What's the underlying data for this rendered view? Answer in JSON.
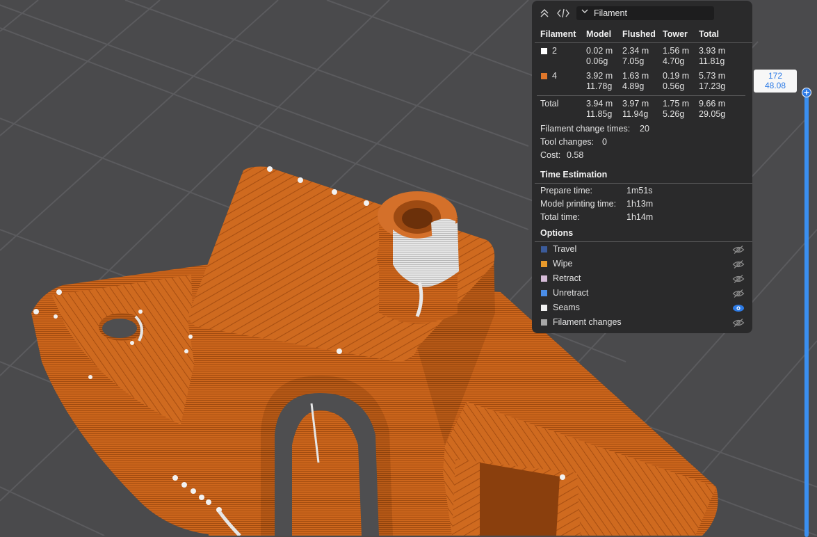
{
  "header": {
    "collapse_icon": "double-chevron-up-icon",
    "code_icon": "code-brackets-icon",
    "view_type": "Filament"
  },
  "table": {
    "columns": [
      "Filament",
      "Model",
      "Flushed",
      "Tower",
      "Total"
    ],
    "rows": [
      {
        "filament": "2",
        "color": "#ffffff",
        "model": [
          "0.02 m",
          "0.06g"
        ],
        "flushed": [
          "2.34 m",
          "7.05g"
        ],
        "tower": [
          "1.56 m",
          "4.70g"
        ],
        "total": [
          "3.93 m",
          "11.81g"
        ]
      },
      {
        "filament": "4",
        "color": "#e0772a",
        "model": [
          "3.92 m",
          "11.78g"
        ],
        "flushed": [
          "1.63 m",
          "4.89g"
        ],
        "tower": [
          "0.19 m",
          "0.56g"
        ],
        "total": [
          "5.73 m",
          "17.23g"
        ]
      }
    ],
    "total_row": {
      "label": "Total",
      "model": [
        "3.94 m",
        "11.85g"
      ],
      "flushed": [
        "3.97 m",
        "11.94g"
      ],
      "tower": [
        "1.75 m",
        "5.26g"
      ],
      "total": [
        "9.66 m",
        "29.05g"
      ]
    }
  },
  "stats": {
    "filament_change_label": "Filament change times:",
    "filament_change_value": "20",
    "tool_changes_label": "Tool changes:",
    "tool_changes_value": "0",
    "cost_label": "Cost:",
    "cost_value": "0.58"
  },
  "time": {
    "title": "Time Estimation",
    "prepare_label": "Prepare time:",
    "prepare_value": "1m51s",
    "model_label": "Model printing time:",
    "model_value": "1h13m",
    "total_label": "Total time:",
    "total_value": "1h14m"
  },
  "options": {
    "title": "Options",
    "items": [
      {
        "label": "Travel",
        "color": "#3b5b9a",
        "visible": false
      },
      {
        "label": "Wipe",
        "color": "#e89a2b",
        "visible": false
      },
      {
        "label": "Retract",
        "color": "#d6bcd8",
        "visible": false
      },
      {
        "label": "Unretract",
        "color": "#4a8de8",
        "visible": false
      },
      {
        "label": "Seams",
        "color": "#f0f0f0",
        "visible": true
      },
      {
        "label": "Filament changes",
        "color": "#a8a8a8",
        "visible": false
      }
    ]
  },
  "layer_slider": {
    "layer": "172",
    "height": "48.08",
    "handle_icon": "plus-icon"
  },
  "colors": {
    "model_orange": "#d2691e",
    "accent_blue": "#2d7be6",
    "bed_gray": "#4a4a4c"
  }
}
